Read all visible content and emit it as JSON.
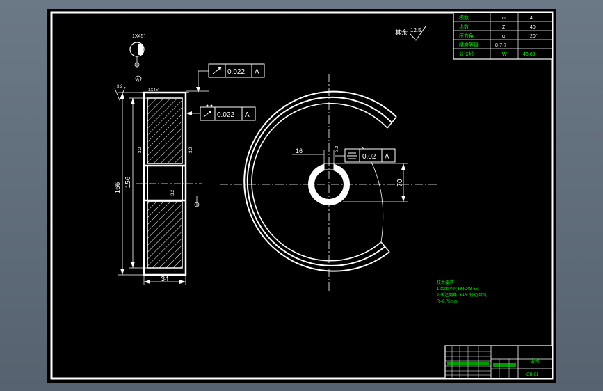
{
  "drawing": {
    "tolerances": {
      "runout_1": {
        "value": "0.022",
        "datum": "A"
      },
      "runout_2": {
        "value": "0.022",
        "datum": "A"
      },
      "symmetry": {
        "value": "0.02",
        "datum": "A"
      }
    },
    "dimensions": {
      "outer_diameter": "166",
      "root_diameter": "156",
      "width": "34",
      "keyway_width": "16",
      "keyway_depth": "70"
    },
    "surface": {
      "remaining_label": "其余",
      "remaining_value": "12.5",
      "chamfer": "1X45°",
      "ra_value": "3.2"
    },
    "datum_label": "A",
    "notes": {
      "title": "技术要求",
      "line1": "1.齿面淬火 HRC48-55;",
      "line2": "2.未注倒角1X45°,锐边倒钝;",
      "line3": "R=0.75mm"
    },
    "params_table": {
      "rows": [
        {
          "name": "模数",
          "sym": "m",
          "val": "4"
        },
        {
          "name": "齿数",
          "sym": "Z",
          "val": "40"
        },
        {
          "name": "压力角",
          "sym": "α",
          "val": "20°"
        },
        {
          "name": "精度等级",
          "sym": "",
          "val": "8-7-7"
        },
        {
          "name": "公法线",
          "sym": "W",
          "val": "43.68"
        }
      ]
    },
    "title_block": {
      "name": "齿轮",
      "code": "GB-01"
    }
  },
  "colors": {
    "background": "#000000",
    "lines": "#ffffff",
    "annotation": "#00ff00",
    "border": "#ffffff"
  }
}
